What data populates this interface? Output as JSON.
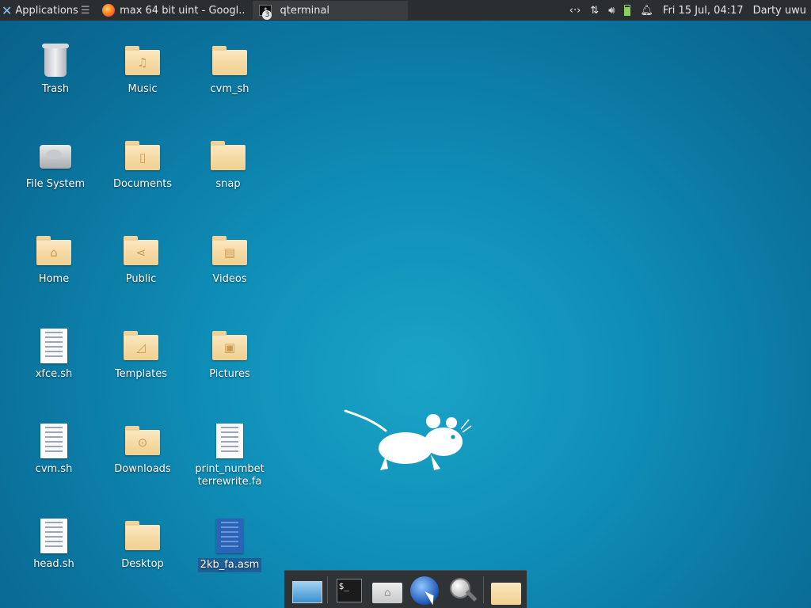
{
  "panel": {
    "applications_label": "Applications",
    "tasks": [
      {
        "title": "max 64 bit uint - Googl..."
      },
      {
        "title": "qterminal",
        "badge": "3"
      }
    ],
    "tray": {
      "clock": "Fri 15 Jul, 04:17",
      "user": "Darty uwu"
    }
  },
  "desktop": {
    "icons": [
      {
        "label": "Trash"
      },
      {
        "label": "Music"
      },
      {
        "label": "cvm_sh"
      },
      {
        "label": "File System"
      },
      {
        "label": "Documents"
      },
      {
        "label": "snap"
      },
      {
        "label": "Home"
      },
      {
        "label": "Public"
      },
      {
        "label": "Videos"
      },
      {
        "label": "xfce.sh"
      },
      {
        "label": "Templates"
      },
      {
        "label": "Pictures"
      },
      {
        "label": "cvm.sh"
      },
      {
        "label": "Downloads"
      },
      {
        "label": "print_numbet terrewrite.fa"
      },
      {
        "label": "head.sh"
      },
      {
        "label": "Desktop"
      },
      {
        "label": "2kb_fa.asm"
      }
    ]
  },
  "colors": {
    "panel": "#2b2e31",
    "desktop_accent": "#0f8fb8",
    "selection": "#1f5e96",
    "folder": "#f1cf8f"
  }
}
